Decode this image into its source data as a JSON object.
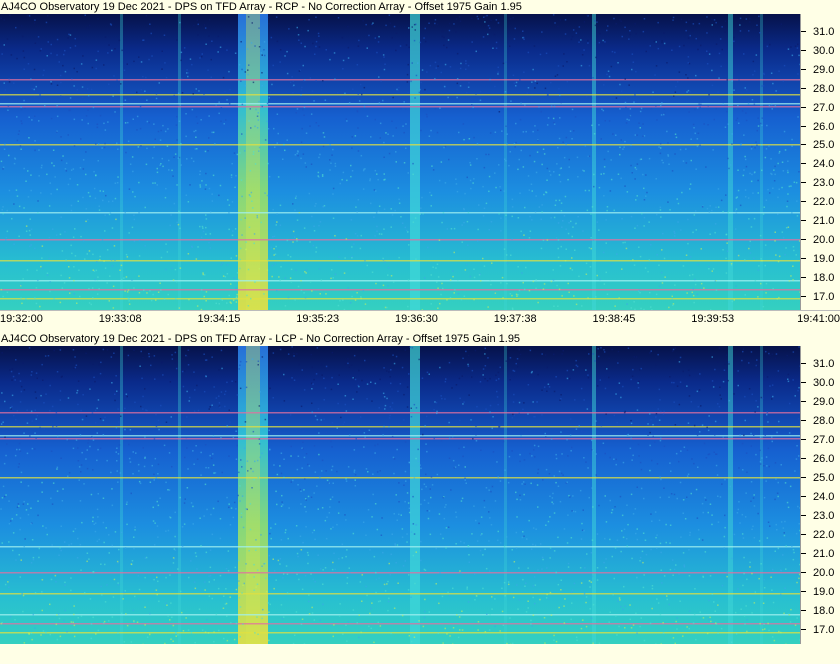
{
  "panels": [
    {
      "id": "rcp",
      "title": "AJ4CO Observatory 19 Dec 2021 - DPS on TFD Array  - RCP  -  No Correction Array  -  Offset 1975  Gain 1.95"
    },
    {
      "id": "lcp",
      "title": "AJ4CO Observatory 19 Dec 2021 - DPS on TFD Array  - LCP  -  No Correction Array  -  Offset 1975  Gain 1.95"
    }
  ],
  "freq_ticks": [
    "31.0",
    "30.0",
    "29.0",
    "28.0",
    "27.0",
    "26.0",
    "25.0",
    "24.0",
    "23.0",
    "22.0",
    "21.0",
    "20.0",
    "19.0",
    "18.0",
    "17.0"
  ],
  "time_ticks": [
    "19:32:00",
    "19:33:08",
    "19:34:15",
    "19:35:23",
    "19:36:30",
    "19:37:38",
    "19:38:45",
    "19:39:53",
    "19:41:00"
  ],
  "colors": {
    "background": "#ffffe6",
    "spectro_top": "#0a1a5a",
    "spectro_mid": "#1a6ad8",
    "spectro_low": "#28c8d8",
    "burst": "#e0f040"
  }
}
